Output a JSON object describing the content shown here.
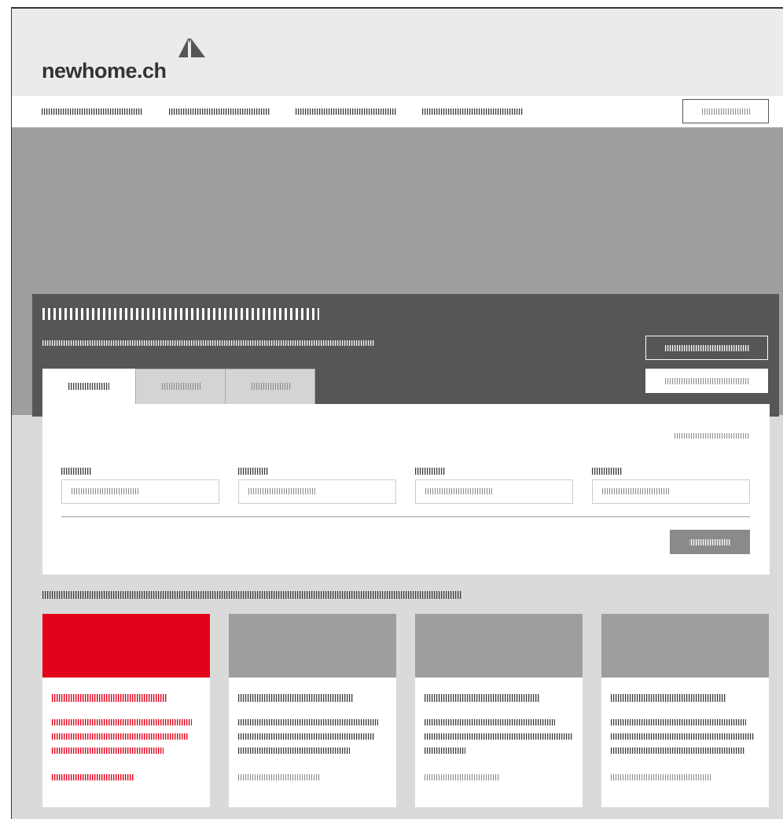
{
  "brand": {
    "name": "newhome.ch"
  },
  "colors": {
    "accent": "#e2001a",
    "dark": "#575655",
    "hero": "#9e9e9c",
    "bg": "#dadada"
  },
  "nav": {
    "items": [
      "",
      "",
      "",
      ""
    ],
    "button": ""
  },
  "hero_panel": {
    "title": "",
    "subtitle": "",
    "button_primary": "",
    "button_secondary": ""
  },
  "tabs": [
    "",
    "",
    ""
  ],
  "form": {
    "link": "",
    "fields": [
      {
        "label": "",
        "placeholder": ""
      },
      {
        "label": "",
        "placeholder": ""
      },
      {
        "label": "",
        "placeholder": ""
      },
      {
        "label": "",
        "placeholder": ""
      }
    ],
    "submit": ""
  },
  "section": {
    "title": ""
  },
  "cards": [
    {
      "title": "",
      "body": "",
      "link": ""
    },
    {
      "title": "",
      "body": "",
      "link": ""
    },
    {
      "title": "",
      "body": "",
      "link": ""
    },
    {
      "title": "",
      "body": "",
      "link": ""
    }
  ],
  "icons": {
    "logo": "house-roof-icon"
  }
}
